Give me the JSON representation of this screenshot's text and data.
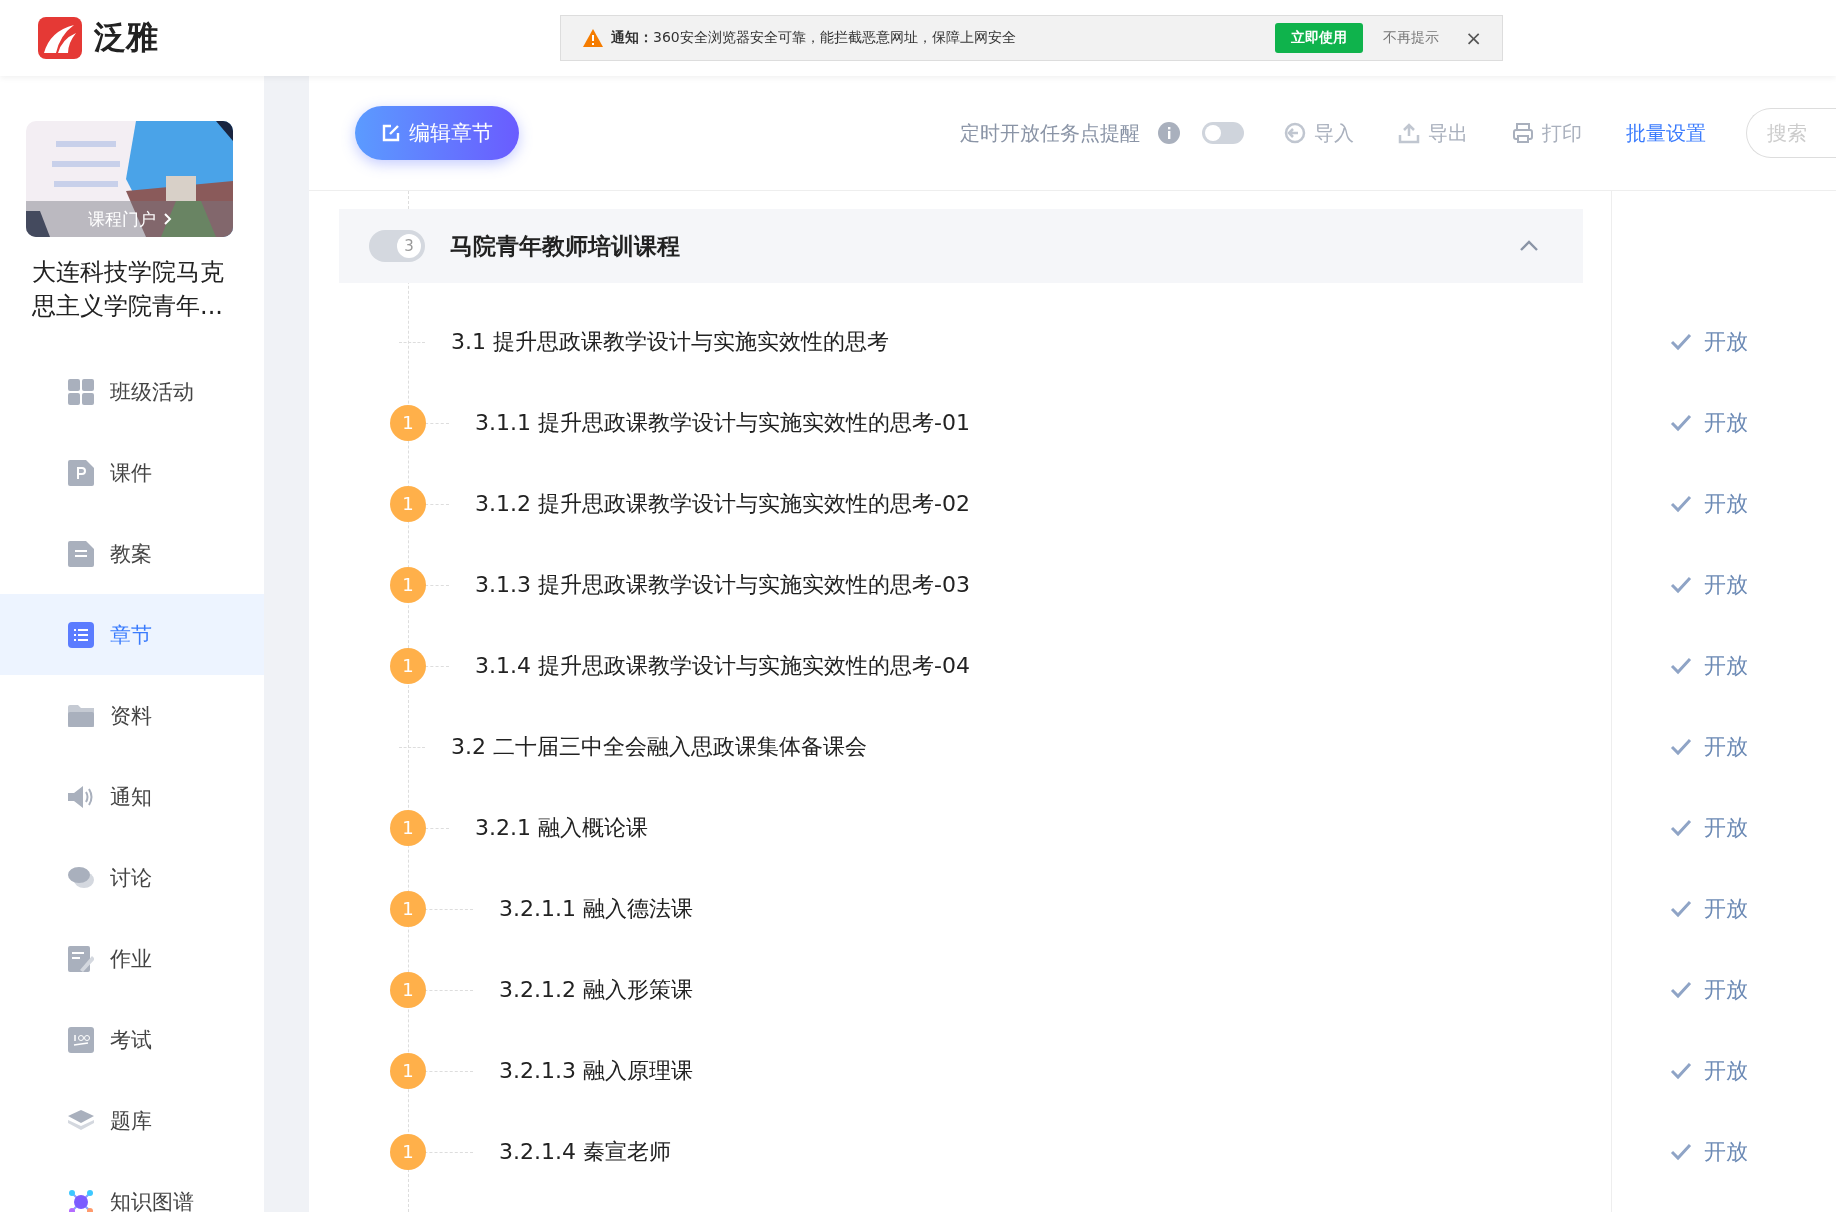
{
  "brand": {
    "name": "泛雅"
  },
  "notice": {
    "label": "通知：",
    "text": "360安全浏览器安全可靠，能拦截恶意网址，保障上网安全",
    "action": "立即使用",
    "dismiss": "不再提示",
    "close": "×"
  },
  "course": {
    "portal_link": "课程门户",
    "title": "大连科技学院马克思主义学院青年..."
  },
  "sidebar": {
    "items": [
      {
        "label": "班级活动",
        "kind": "grid",
        "selected": false
      },
      {
        "label": "课件",
        "kind": "ppt",
        "selected": false
      },
      {
        "label": "教案",
        "kind": "doc",
        "selected": false
      },
      {
        "label": "章节",
        "kind": "list",
        "selected": true
      },
      {
        "label": "资料",
        "kind": "folder",
        "selected": false
      },
      {
        "label": "通知",
        "kind": "speaker",
        "selected": false
      },
      {
        "label": "讨论",
        "kind": "chat",
        "selected": false
      },
      {
        "label": "作业",
        "kind": "edit",
        "selected": false
      },
      {
        "label": "考试",
        "kind": "exam",
        "selected": false
      },
      {
        "label": "题库",
        "kind": "layers",
        "selected": false
      },
      {
        "label": "知识图谱",
        "kind": "graph",
        "selected": false
      }
    ]
  },
  "toolbar": {
    "edit_button": "编辑章节",
    "reminder_label": "定时开放任务点提醒",
    "reminder_on": false,
    "import": "导入",
    "export": "导出",
    "print": "打印",
    "batch": "批量设置",
    "search_placeholder": "搜索"
  },
  "chapter": {
    "count": "3",
    "title": "马院青年教师培训课程",
    "expanded": true,
    "children": [
      {
        "label": "3.1 提升思政课教学设计与实施实效性的思考",
        "status": "开放",
        "children": [
          {
            "label": "3.1.1 提升思政课教学设计与实施实效性的思考-01",
            "badge": "1",
            "status": "开放"
          },
          {
            "label": "3.1.2 提升思政课教学设计与实施实效性的思考-02",
            "badge": "1",
            "status": "开放"
          },
          {
            "label": "3.1.3 提升思政课教学设计与实施实效性的思考-03",
            "badge": "1",
            "status": "开放"
          },
          {
            "label": "3.1.4 提升思政课教学设计与实施实效性的思考-04",
            "badge": "1",
            "status": "开放"
          }
        ]
      },
      {
        "label": "3.2 二十届三中全会融入思政课集体备课会",
        "status": "开放",
        "children": [
          {
            "label": "3.2.1 融入概论课",
            "badge": "1",
            "status": "开放",
            "children": [
              {
                "label": "3.2.1.1 融入德法课",
                "badge": "1",
                "status": "开放"
              },
              {
                "label": "3.2.1.2 融入形策课",
                "badge": "1",
                "status": "开放"
              },
              {
                "label": "3.2.1.3 融入原理课",
                "badge": "1",
                "status": "开放"
              },
              {
                "label": "3.2.1.4 秦宣老师",
                "badge": "1",
                "status": "开放"
              }
            ]
          }
        ]
      }
    ]
  }
}
